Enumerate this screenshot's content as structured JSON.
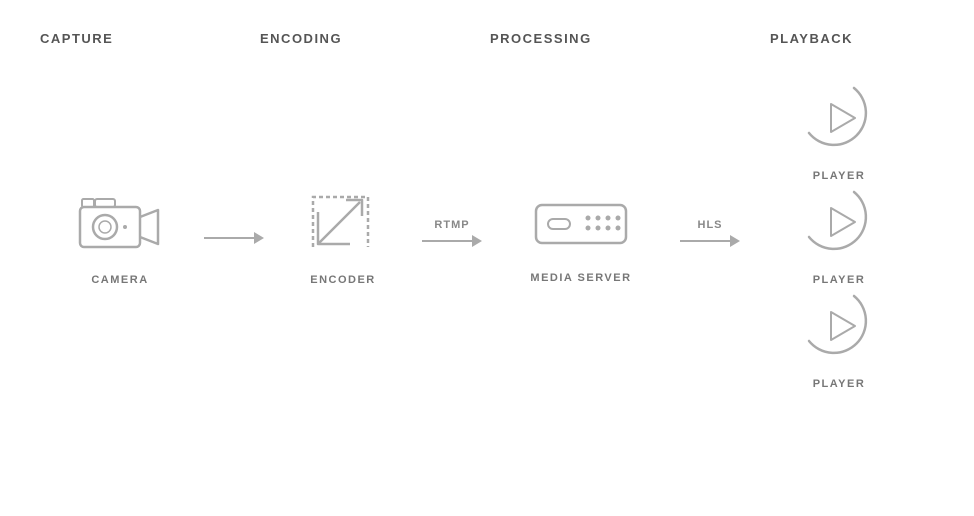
{
  "sections": {
    "capture": {
      "header": "CAPTURE",
      "icon": "camera-icon",
      "label": "CAMERA"
    },
    "encoding": {
      "header": "ENCODING",
      "icon": "encoder-icon",
      "label": "ENCODER"
    },
    "processing": {
      "header": "PROCESSING",
      "icon": "server-icon",
      "label": "MEDIA SERVER"
    },
    "playback": {
      "header": "PLAYBACK",
      "icon": "player-icon",
      "label": "PLAYER"
    }
  },
  "arrows": {
    "rtmp": "RTMP",
    "hls": "HLS"
  },
  "players": [
    {
      "id": 1,
      "label": "PLAYER"
    },
    {
      "id": 2,
      "label": "PLAYER"
    },
    {
      "id": 3,
      "label": "PLAYER"
    }
  ]
}
